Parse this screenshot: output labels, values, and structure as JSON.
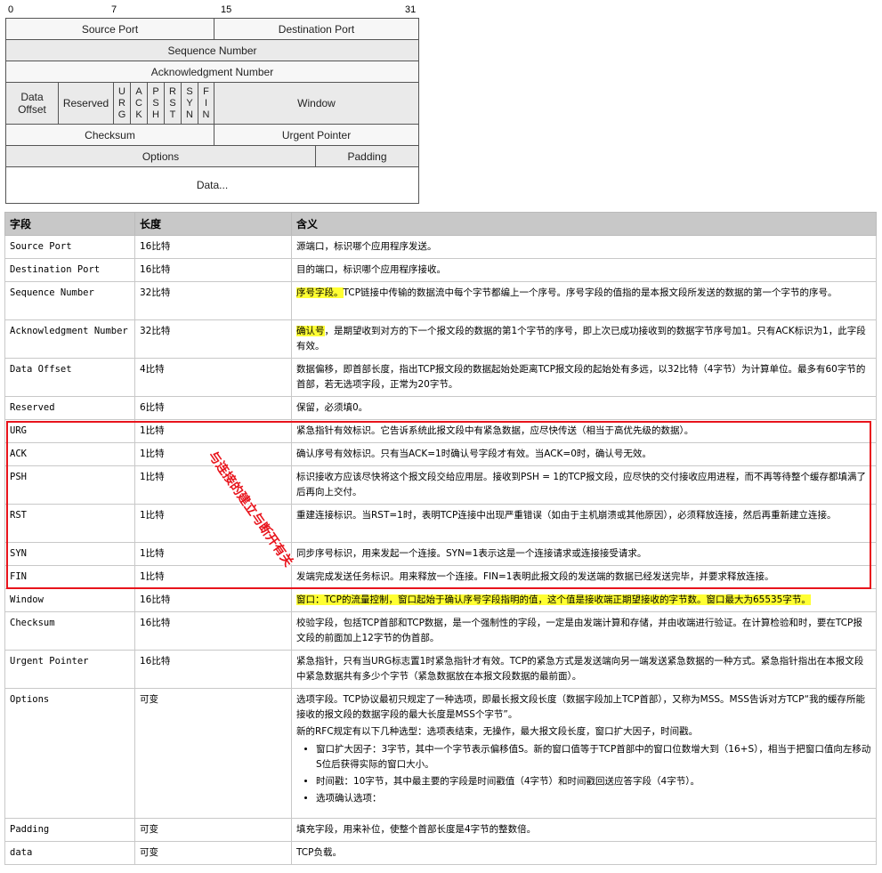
{
  "diagram": {
    "bit_labels": [
      "0",
      "7",
      "15",
      "31"
    ],
    "source_port": "Source Port",
    "destination_port": "Destination Port",
    "sequence_number": "Sequence Number",
    "acknowledgment_number": "Acknowledgment Number",
    "data_offset": "Data\nOffset",
    "reserved": "Reserved",
    "flags": [
      "U\nR\nG",
      "A\nC\nK",
      "P\nS\nH",
      "R\nS\nT",
      "S\nY\nN",
      "F\nI\nN"
    ],
    "window": "Window",
    "checksum": "Checksum",
    "urgent_pointer": "Urgent Pointer",
    "options": "Options",
    "padding": "Padding",
    "data": "Data..."
  },
  "table": {
    "headers": [
      "字段",
      "长度",
      "含义"
    ],
    "rows": [
      {
        "field": "Source Port",
        "length": "16比特",
        "meaning": "源端口，标识哪个应用程序发送。"
      },
      {
        "field": "Destination Port",
        "length": "16比特",
        "meaning": "目的端口，标识哪个应用程序接收。"
      },
      {
        "field": "Sequence Number",
        "length": "32比特",
        "meaning_hl": "序号字段。",
        "meaning": "TCP链接中传输的数据流中每个字节都编上一个序号。序号字段的值指的是本报文段所发送的数据的第一个字节的序号。"
      },
      {
        "field": "Acknowledgment Number",
        "length": "32比特",
        "meaning_hl": "确认号",
        "meaning": "，是期望收到对方的下一个报文段的数据的第1个字节的序号，即上次已成功接收到的数据字节序号加1。只有ACK标识为1，此字段有效。"
      },
      {
        "field": "Data Offset",
        "length": "4比特",
        "meaning": "数据偏移，即首部长度，指出TCP报文段的数据起始处距离TCP报文段的起始处有多远，以32比特（4字节）为计算单位。最多有60字节的首部，若无选项字段，正常为20字节。"
      },
      {
        "field": "Reserved",
        "length": "6比特",
        "meaning": "保留，必须填0。"
      },
      {
        "field": "URG",
        "length": "1比特",
        "meaning": "紧急指针有效标识。它告诉系统此报文段中有紧急数据，应尽快传送（相当于高优先级的数据）。"
      },
      {
        "field": "ACK",
        "length": "1比特",
        "meaning": "确认序号有效标识。只有当ACK=1时确认号字段才有效。当ACK=0时，确认号无效。"
      },
      {
        "field": "PSH",
        "length": "1比特",
        "meaning": "标识接收方应该尽快将这个报文段交给应用层。接收到PSH = 1的TCP报文段，应尽快的交付接收应用进程，而不再等待整个缓存都填满了后再向上交付。"
      },
      {
        "field": "RST",
        "length": "1比特",
        "meaning": "重建连接标识。当RST=1时，表明TCP连接中出现严重错误（如由于主机崩溃或其他原因），必须释放连接，然后再重新建立连接。"
      },
      {
        "field": "SYN",
        "length": "1比特",
        "meaning": "同步序号标识，用来发起一个连接。SYN=1表示这是一个连接请求或连接接受请求。"
      },
      {
        "field": "FIN",
        "length": "1比特",
        "meaning": "发端完成发送任务标识。用来释放一个连接。FIN=1表明此报文段的发送端的数据已经发送完毕，并要求释放连接。"
      },
      {
        "field": "Window",
        "length": "16比特",
        "meaning_hl": "窗口：TCP的流量控制，窗口起始于确认序号字段指明的值，这个值是接收端正期望接收的字节数。窗口最大为65535字节。",
        "meaning": ""
      },
      {
        "field": "Checksum",
        "length": "16比特",
        "meaning": "校验字段，包括TCP首部和TCP数据，是一个强制性的字段，一定是由发端计算和存储，并由收端进行验证。在计算检验和时，要在TCP报文段的前面加上12字节的伪首部。"
      },
      {
        "field": "Urgent Pointer",
        "length": "16比特",
        "meaning": "紧急指针，只有当URG标志置1时紧急指针才有效。TCP的紧急方式是发送端向另一端发送紧急数据的一种方式。紧急指针指出在本报文段中紧急数据共有多少个字节（紧急数据放在本报文段数据的最前面）。"
      },
      {
        "field": "Options",
        "length": "可变",
        "meaning": "选项字段。TCP协议最初只规定了一种选项，即最长报文段长度（数据字段加上TCP首部），又称为MSS。MSS告诉对方TCP“我的缓存所能接收的报文段的数据字段的最大长度是MSS个字节”。",
        "meaning_2": "新的RFC规定有以下几种选型：选项表结束，无操作，最大报文段长度，窗口扩大因子，时间戳。",
        "bullets": [
          "窗口扩大因子：3字节，其中一个字节表示偏移值S。新的窗口值等于TCP首部中的窗口位数增大到（16+S），相当于把窗口值向左移动S位后获得实际的窗口大小。",
          "时间戳：10字节，其中最主要的字段是时间戳值（4字节）和时间戳回送应答字段（4字节）。",
          "选项确认选项："
        ]
      },
      {
        "field": "Padding",
        "length": "可变",
        "meaning": "填充字段，用来补位，使整个首部长度是4字节的整数倍。"
      },
      {
        "field": "data",
        "length": "可变",
        "meaning": "TCP负载。"
      }
    ]
  },
  "annotation": "与连接的建立与断开有关",
  "colors": {
    "highlight": "#ffff33",
    "annotation_red": "#e8141c",
    "header_gray": "#c8c8c8"
  }
}
